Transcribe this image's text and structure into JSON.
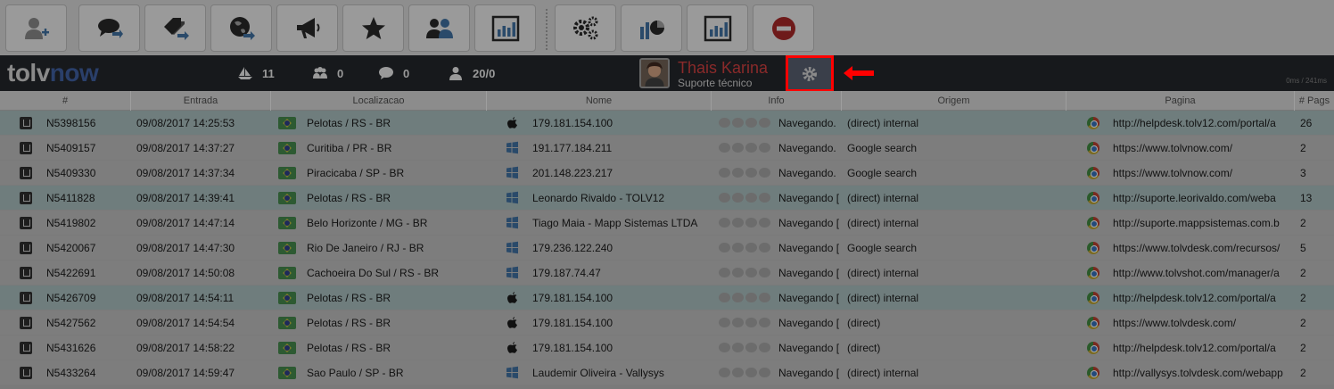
{
  "toolbar": {
    "buttons": [
      {
        "name": "add-user",
        "icon": "add-user-icon"
      },
      {
        "name": "chat-forward",
        "icon": "chat-forward-icon"
      },
      {
        "name": "tags-forward",
        "icon": "tags-forward-icon"
      },
      {
        "name": "globe-forward",
        "icon": "globe-forward-icon"
      },
      {
        "name": "megaphone",
        "icon": "megaphone-icon"
      },
      {
        "name": "favorites",
        "icon": "star-icon"
      },
      {
        "name": "users",
        "icon": "users-icon"
      },
      {
        "name": "reports",
        "icon": "bar-chart-icon"
      },
      {
        "name": "settings",
        "icon": "gears-icon"
      },
      {
        "name": "analytics",
        "icon": "pie-bar-chart-icon"
      },
      {
        "name": "statistics",
        "icon": "bar-chart-icon"
      },
      {
        "name": "block",
        "icon": "stop-icon"
      }
    ]
  },
  "header": {
    "logo_part1": "tolv",
    "logo_part2": "now",
    "stats": {
      "sailing": "11",
      "groups": "0",
      "chats": "0",
      "users": "20/0"
    },
    "user": {
      "name": "Thais Karina",
      "role": "Suporte técnico"
    },
    "timing": "0ms / 241ms"
  },
  "table": {
    "headers": [
      "#",
      "Entrada",
      "Localizacao",
      "Nome",
      "Info",
      "Origem",
      "Pagina",
      "# Pags"
    ],
    "rows": [
      {
        "id": "N5398156",
        "entrada": "09/08/2017 14:25:53",
        "loc": "Pelotas / RS - BR",
        "os": "apple",
        "nome": "179.181.154.100",
        "info": "Navegando.",
        "origem": "(direct) internal",
        "pagina": "http://helpdesk.tolv12.com/portal/a",
        "pags": "26",
        "hl": true
      },
      {
        "id": "N5409157",
        "entrada": "09/08/2017 14:37:27",
        "loc": "Curitiba / PR - BR",
        "os": "windows",
        "nome": "191.177.184.211",
        "info": "Navegando.",
        "origem": "Google search",
        "pagina": "https://www.tolvnow.com/",
        "pags": "2",
        "hl": false
      },
      {
        "id": "N5409330",
        "entrada": "09/08/2017 14:37:34",
        "loc": "Piracicaba / SP - BR",
        "os": "windows",
        "nome": "201.148.223.217",
        "info": "Navegando.",
        "origem": "Google search",
        "pagina": "https://www.tolvnow.com/",
        "pags": "3",
        "hl": false
      },
      {
        "id": "N5411828",
        "entrada": "09/08/2017 14:39:41",
        "loc": "Pelotas / RS - BR",
        "os": "windows",
        "nome": "Leonardo Rivaldo - TOLV12",
        "info": "Navegando [",
        "origem": "(direct) internal",
        "pagina": "http://suporte.leorivaldo.com/weba",
        "pags": "13",
        "hl": true
      },
      {
        "id": "N5419802",
        "entrada": "09/08/2017 14:47:14",
        "loc": "Belo Horizonte / MG - BR",
        "os": "windows",
        "nome": "Tiago Maia - Mapp Sistemas LTDA",
        "info": "Navegando [",
        "origem": "(direct) internal",
        "pagina": "http://suporte.mappsistemas.com.b",
        "pags": "2",
        "hl": false
      },
      {
        "id": "N5420067",
        "entrada": "09/08/2017 14:47:30",
        "loc": "Rio De Janeiro / RJ - BR",
        "os": "windows",
        "nome": "179.236.122.240",
        "info": "Navegando [",
        "origem": "Google search",
        "pagina": "https://www.tolvdesk.com/recursos/",
        "pags": "5",
        "hl": false
      },
      {
        "id": "N5422691",
        "entrada": "09/08/2017 14:50:08",
        "loc": "Cachoeira Do Sul / RS - BR",
        "os": "windows",
        "nome": "179.187.74.47",
        "info": "Navegando [",
        "origem": "(direct) internal",
        "pagina": "http://www.tolvshot.com/manager/a",
        "pags": "2",
        "hl": false
      },
      {
        "id": "N5426709",
        "entrada": "09/08/2017 14:54:11",
        "loc": "Pelotas / RS - BR",
        "os": "apple",
        "nome": "179.181.154.100",
        "info": "Navegando [",
        "origem": "(direct) internal",
        "pagina": "http://helpdesk.tolv12.com/portal/a",
        "pags": "2",
        "hl": true
      },
      {
        "id": "N5427562",
        "entrada": "09/08/2017 14:54:54",
        "loc": "Pelotas / RS - BR",
        "os": "apple",
        "nome": "179.181.154.100",
        "info": "Navegando [",
        "origem": "(direct)",
        "pagina": "https://www.tolvdesk.com/",
        "pags": "2",
        "hl": false
      },
      {
        "id": "N5431626",
        "entrada": "09/08/2017 14:58:22",
        "loc": "Pelotas / RS - BR",
        "os": "apple",
        "nome": "179.181.154.100",
        "info": "Navegando [",
        "origem": "(direct)",
        "pagina": "http://helpdesk.tolv12.com/portal/a",
        "pags": "2",
        "hl": false
      },
      {
        "id": "N5433264",
        "entrada": "09/08/2017 14:59:47",
        "loc": "Sao Paulo / SP - BR",
        "os": "windows",
        "nome": "Laudemir Oliveira - Vallysys",
        "info": "Navegando [",
        "origem": "(direct) internal",
        "pagina": "http://vallysys.tolvdesk.com/webapp",
        "pags": "2",
        "hl": false
      }
    ]
  },
  "colors": {
    "header_bg": "#17191c",
    "highlight_box": "#ff0000",
    "arrow": "#ff0000"
  }
}
